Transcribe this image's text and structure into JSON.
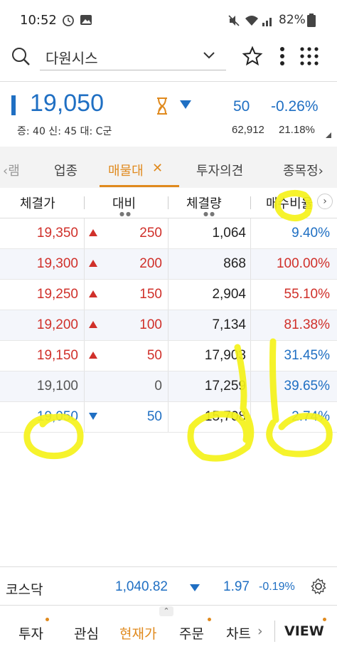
{
  "status_bar": {
    "time": "10:52",
    "battery": "82%"
  },
  "search": {
    "value": "다원시스"
  },
  "quote": {
    "price": "19,050",
    "change": "50",
    "change_pct": "-0.26%",
    "margin_info": "증: 40 신: 45 대: C군",
    "volume": "62,912",
    "turnover": "21.18%"
  },
  "tabs": [
    {
      "label": "‹램"
    },
    {
      "label": "업종"
    },
    {
      "label": "매물대"
    },
    {
      "label": "투자의견"
    },
    {
      "label": "종목정›"
    }
  ],
  "table": {
    "headers": [
      "체결가",
      "대비",
      "체결량",
      "매수비율"
    ],
    "rows": [
      {
        "price": "19,350",
        "dir": "up",
        "diff": "250",
        "volume": "1,064",
        "ratio": "9.40%",
        "price_color": "red",
        "ratio_color": "blue"
      },
      {
        "price": "19,300",
        "dir": "up",
        "diff": "200",
        "volume": "868",
        "ratio": "100.00%",
        "price_color": "red",
        "ratio_color": "red"
      },
      {
        "price": "19,250",
        "dir": "up",
        "diff": "150",
        "volume": "2,904",
        "ratio": "55.10%",
        "price_color": "red",
        "ratio_color": "red"
      },
      {
        "price": "19,200",
        "dir": "up",
        "diff": "100",
        "volume": "7,134",
        "ratio": "81.38%",
        "price_color": "red",
        "ratio_color": "red"
      },
      {
        "price": "19,150",
        "dir": "up",
        "diff": "50",
        "volume": "17,903",
        "ratio": "31.45%",
        "price_color": "red",
        "ratio_color": "blue"
      },
      {
        "price": "19,100",
        "dir": "none",
        "diff": "0",
        "volume": "17,259",
        "ratio": "39.65%",
        "price_color": "gray",
        "ratio_color": "blue"
      },
      {
        "price": "19,050",
        "dir": "down",
        "diff": "50",
        "volume": "15,708",
        "ratio": "2.74%",
        "price_color": "blue",
        "ratio_color": "blue"
      }
    ]
  },
  "index_bar": {
    "name": "코스닥",
    "value": "1,040.82",
    "change": "1.97",
    "change_pct": "-0.19%"
  },
  "bottom_nav": [
    {
      "label": "투자"
    },
    {
      "label": "관심"
    },
    {
      "label": "현재가"
    },
    {
      "label": "주문"
    },
    {
      "label": "차트"
    },
    {
      "label": "VIEW"
    }
  ],
  "colors": {
    "up": "#d0302a",
    "down": "#1f6fc3",
    "accent": "#e08a1e",
    "highlight": "#f5f21a"
  },
  "icons": [
    "search-icon",
    "chevron-down-icon",
    "star-icon",
    "kebab-menu-icon",
    "grid-menu-icon",
    "hourglass-icon",
    "settings-icon"
  ]
}
